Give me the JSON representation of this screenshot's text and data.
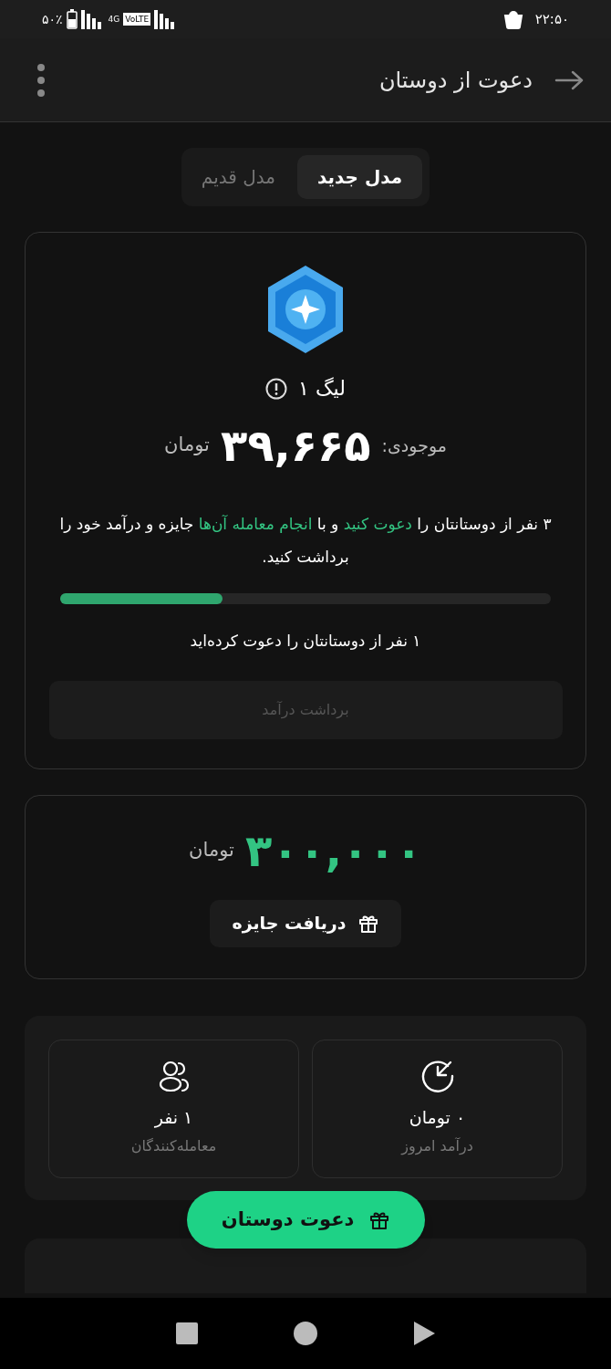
{
  "status_bar": {
    "time": "۲۲:۵۰",
    "battery": "۵۰٪",
    "network": "4G",
    "volte": "VoLTE"
  },
  "app_bar": {
    "title": "دعوت از دوستان"
  },
  "tabs": [
    {
      "label": "مدل جدید",
      "selected": true
    },
    {
      "label": "مدل قدیم",
      "selected": false
    }
  ],
  "league_card": {
    "league": "لیگ ۱",
    "balance_label": "موجودی:",
    "balance": "۳۹,۶۶۵",
    "currency": "تومان",
    "description": [
      {
        "kind": "plain",
        "text": "۳ نفر از دوستانتان را "
      },
      {
        "kind": "link",
        "text": "دعوت کنید"
      },
      {
        "kind": "plain",
        "text": " و با "
      },
      {
        "kind": "link",
        "text": "انجام معامله آن‌ها"
      },
      {
        "kind": "plain",
        "text": " جایزه و درآمد خود را برداشت کنید."
      }
    ],
    "progress": {
      "level": 0.33
    },
    "progress_caption": "۱ نفر از دوستانتان را دعوت کرده‌اید",
    "withdraw_button": {
      "label": "برداشت درآمد",
      "disabled": true
    }
  },
  "reward_card": {
    "amount": "۳۰۰,۰۰۰",
    "currency": "تومان",
    "button": "دریافت جایزه"
  },
  "stats": [
    {
      "kind": "income",
      "value": "۰ تومان",
      "label": "درآمد امروز"
    },
    {
      "kind": "traders",
      "value": "۱ نفر",
      "label": "معامله‌کنندگان"
    }
  ],
  "invite_button": "دعوت دوستان"
}
